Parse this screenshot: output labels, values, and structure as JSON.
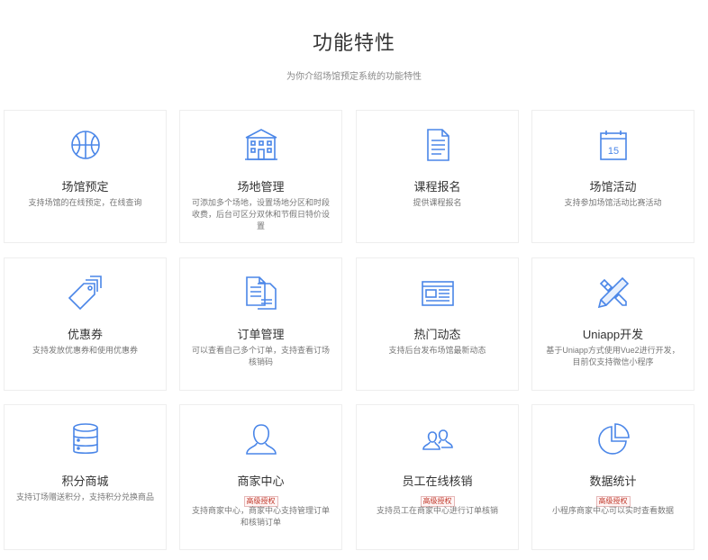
{
  "section": {
    "title": "功能特性",
    "subtitle": "为你介绍场馆预定系统的功能特性"
  },
  "features": [
    {
      "title": "场馆预定",
      "desc": "支持场馆的在线预定，在线查询",
      "icon": "basketball-icon",
      "tag": ""
    },
    {
      "title": "场地管理",
      "desc": "可添加多个场地，设置场地分区和时段收费，后台可区分双休和节假日特价设置",
      "icon": "building-icon",
      "tag": ""
    },
    {
      "title": "课程报名",
      "desc": "提供课程报名",
      "icon": "document-icon",
      "tag": ""
    },
    {
      "title": "场馆活动",
      "desc": "支持参加场馆活动比赛活动",
      "icon": "calendar-icon",
      "tag": ""
    },
    {
      "title": "优惠券",
      "desc": "支持发放优惠券和使用优惠券",
      "icon": "price-tag-icon",
      "tag": ""
    },
    {
      "title": "订单管理",
      "desc": "可以查看自己多个订单，支持查看订场核销码",
      "icon": "order-documents-icon",
      "tag": ""
    },
    {
      "title": "热门动态",
      "desc": "支持后台发布场馆最新动态",
      "icon": "newspaper-icon",
      "tag": ""
    },
    {
      "title": "Uniapp开发",
      "desc": "基于Uniapp方式使用Vue2进行开发，目前仅支持微信小程序",
      "icon": "pencil-ruler-icon",
      "tag": ""
    },
    {
      "title": "积分商城",
      "desc": "支持订场赠送积分，支持积分兑换商品",
      "icon": "database-icon",
      "tag": ""
    },
    {
      "title": "商家中心",
      "desc": "支持商家中心，商家中心支持管理订单和核销订单",
      "icon": "user-icon",
      "tag": "高级授权"
    },
    {
      "title": "员工在线核销",
      "desc": "支持员工在商家中心进行订单核销",
      "icon": "users-icon",
      "tag": "高级授权"
    },
    {
      "title": "数据统计",
      "desc": "小程序商家中心可以实时查看数据",
      "icon": "pie-chart-icon",
      "tag": "高级授权"
    }
  ],
  "colors": {
    "icon": "#4a86e8",
    "tag": "#c0392b",
    "border": "#eeeeee"
  }
}
